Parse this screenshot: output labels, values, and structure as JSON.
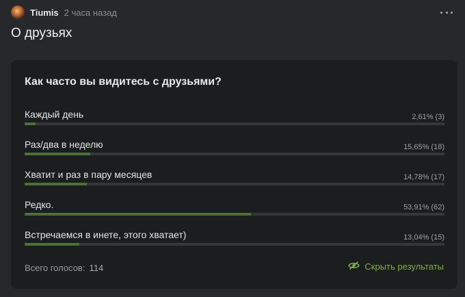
{
  "post": {
    "username": "Tiumis",
    "time": "2 часа назад",
    "title": "О друзьях"
  },
  "poll": {
    "question": "Как часто вы видитесь с друзьями?",
    "options": [
      {
        "label": "Каждый день",
        "value_text": "2,61% (3)",
        "percent": 2.61
      },
      {
        "label": "Раз/два в неделю",
        "value_text": "15,65% (18)",
        "percent": 15.65
      },
      {
        "label": "Хватит и раз в пару месяцев",
        "value_text": "14,78% (17)",
        "percent": 14.78
      },
      {
        "label": "Редко.",
        "value_text": "53,91% (62)",
        "percent": 53.91
      },
      {
        "label": "Встречаемся в инете, этого хватает)",
        "value_text": "13,04% (15)",
        "percent": 13.04
      }
    ],
    "total_label": "Всего голосов:",
    "total_count": "114",
    "hide_results_label": "Скрыть результаты"
  },
  "colors": {
    "background": "#27282b",
    "card": "#1c1d1f",
    "bar_fill": "#4e6f3a",
    "accent": "#7fae4f"
  },
  "icons": {
    "more": "more-dots-icon",
    "hide": "eye-off-icon"
  }
}
